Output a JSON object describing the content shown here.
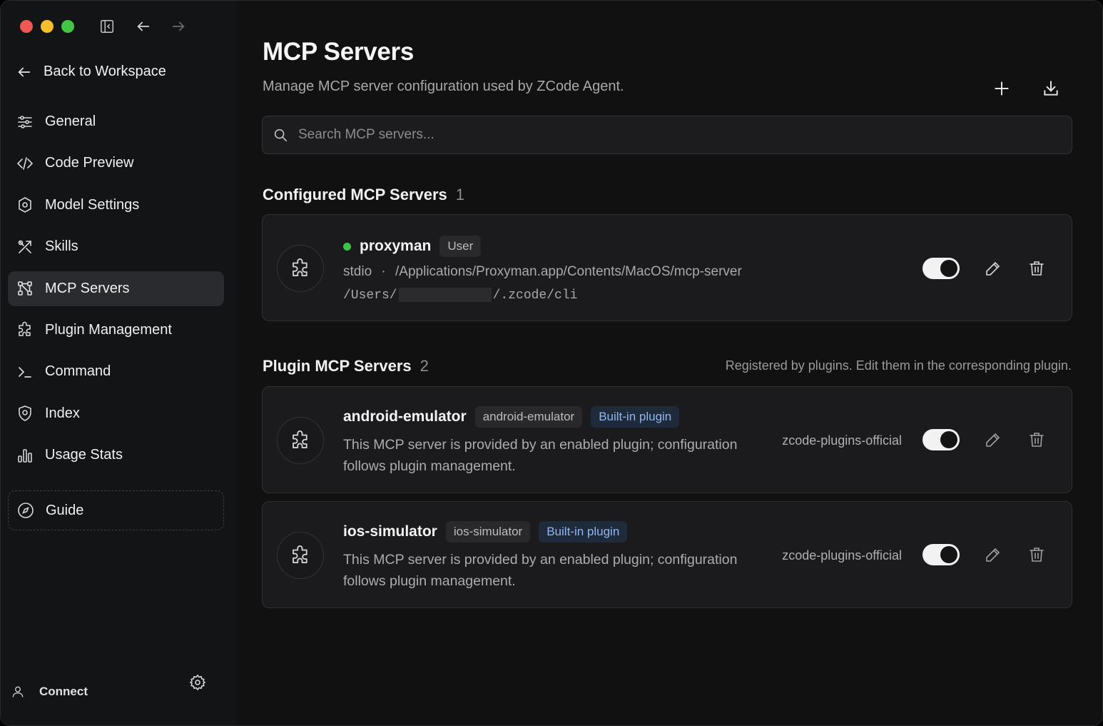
{
  "sidebar": {
    "back_label": "Back to Workspace",
    "items": [
      {
        "label": "General",
        "icon": "sliders-icon"
      },
      {
        "label": "Code Preview",
        "icon": "code-icon"
      },
      {
        "label": "Model Settings",
        "icon": "cube-gear-icon"
      },
      {
        "label": "Skills",
        "icon": "tools-icon"
      },
      {
        "label": "MCP Servers",
        "icon": "network-icon",
        "active": true
      },
      {
        "label": "Plugin Management",
        "icon": "puzzle-icon"
      },
      {
        "label": "Command",
        "icon": "terminal-icon"
      },
      {
        "label": "Index",
        "icon": "shield-icon"
      },
      {
        "label": "Usage Stats",
        "icon": "bar-chart-icon"
      }
    ],
    "guide_label": "Guide",
    "connect_label": "Connect"
  },
  "main": {
    "title": "MCP Servers",
    "subtitle": "Manage MCP server configuration used by ZCode Agent.",
    "search_placeholder": "Search MCP servers...",
    "configured": {
      "title": "Configured MCP Servers",
      "count": "1",
      "servers": [
        {
          "name": "proxyman",
          "status_color": "#3ec34a",
          "tag": "User",
          "transport": "stdio",
          "separator": "·",
          "command": "/Applications/Proxyman.app/Contents/MacOS/mcp-server",
          "cwd_prefix": "/Users/",
          "cwd_suffix": "/.zcode/cli",
          "enabled": true
        }
      ]
    },
    "plugin": {
      "title": "Plugin MCP Servers",
      "count": "2",
      "note": "Registered by plugins. Edit them in the corresponding plugin.",
      "servers": [
        {
          "name": "android-emulator",
          "tag": "android-emulator",
          "badge": "Built-in plugin",
          "description": "This MCP server is provided by an enabled plugin; configuration follows plugin management.",
          "source": "zcode-plugins-official",
          "enabled": true
        },
        {
          "name": "ios-simulator",
          "tag": "ios-simulator",
          "badge": "Built-in plugin",
          "description": "This MCP server is provided by an enabled plugin; configuration follows plugin management.",
          "source": "zcode-plugins-official",
          "enabled": true
        }
      ]
    }
  },
  "colors": {
    "background": "#111112",
    "sidebar": "#131416",
    "card": "#1b1b1d",
    "accent_blue": "#8fb8ef",
    "status_green": "#3ec34a"
  }
}
